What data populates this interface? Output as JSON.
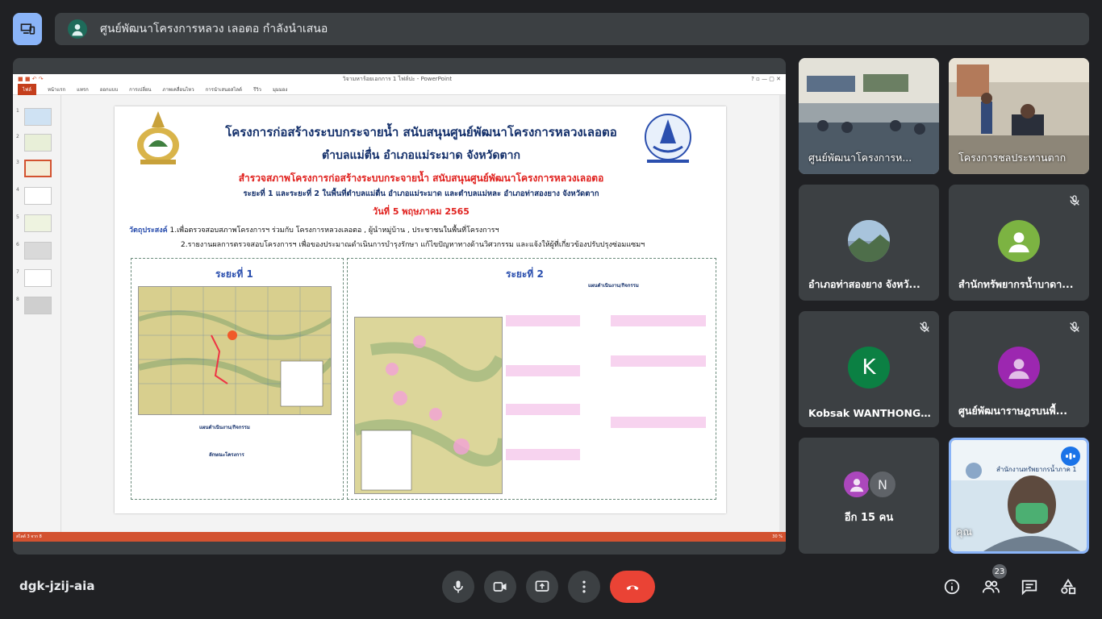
{
  "banner": {
    "title": "ศูนย์พัฒนาโครงการหลวง เลอตอ กำลังนำเสนอ"
  },
  "ppt": {
    "window_title": "วิจามหาร้อยเอกการ 1 ไฟล์ปะ - PowerPoint",
    "ribbon": [
      "ไฟล์",
      "หน้าแรก",
      "แทรก",
      "ออกแบบ",
      "การเปลี่ยน",
      "ภาพเคลื่อนไหว",
      "การนำเสนอสไลด์",
      "รีวิว",
      "มุมมอง"
    ],
    "thumb_numbers": [
      "1",
      "2",
      "3",
      "4",
      "5",
      "6",
      "7",
      "8"
    ],
    "status_left": "สไลด์ 3 จาก 8",
    "status_right": "30 %",
    "slide": {
      "title_line1": "โครงการก่อสร้างระบบกระจายน้ำ สนับสนุนศูนย์พัฒนาโครงการหลวงเลอตอ",
      "title_line2": "ตำบลแม่ตื่น อำเภอแม่ระมาด จังหวัดตาก",
      "subtitle_red": "สำรวจสภาพโครงการก่อสร้างระบบกระจายน้ำ สนับสนุนศูนย์พัฒนาโครงการหลวงเลอตอ",
      "subtitle_blue": "ระยะที่ 1 และระยะที่ 2 ในพื้นที่ตำบลแม่ตื่น อำเภอแม่ระมาด และตำบลแม่หละ อำเภอท่าสองยาง จังหวัดตาก",
      "date": "วันที่ 5 พฤษภาคม 2565",
      "objective_label": "วัตถุประสงค์",
      "objective_1": "1.เพื่อตรวจสอบสภาพโครงการฯ ร่วมกับ โครงการหลวงเลอตอ , ผู้นำหมู่บ้าน , ประชาชนในพื้นที่โครงการฯ",
      "objective_2": "2.รายงานผลการตรวจสอบโครงการฯ เพื่อของประมาณดำเนินการบำรุงรักษา แก้ไขปัญหาทางด้านวิศวกรรม และแจ้งให้ผู้ที่เกี่ยวข้องปรับปรุงซ่อมแซมฯ",
      "phase1": "ระยะที่ 1",
      "phase2": "ระยะที่ 2",
      "phase1_caption": "แผนดำเนินงาน/กิจกรรม",
      "phase1_features": "ลักษณะโครงการ",
      "phase2_caption": "แผนดำเนินงาน/กิจกรรม"
    }
  },
  "tiles": [
    {
      "name": "ศูนย์พัฒนาโครงการห...",
      "type": "video"
    },
    {
      "name": "โครงการชลประทานตาก",
      "type": "video"
    },
    {
      "name": "อำเภอท่าสองยาง จังหวั...",
      "type": "avatar-photo"
    },
    {
      "name": "สำนักทรัพยากรน้ำบาดา...",
      "type": "avatar",
      "color": "#7cb342"
    },
    {
      "name": "Kobsak WANTHONG...",
      "type": "letter",
      "letter": "K",
      "color": "#0b8043"
    },
    {
      "name": "ศูนย์พัฒนาราษฎรบนพื้...",
      "type": "avatar",
      "color": "#9c27b0"
    },
    {
      "name": "อีก 15 คน",
      "type": "more",
      "letter": "N"
    },
    {
      "name": "คุณ",
      "type": "self",
      "overlay": "สำนักงานทรัพยากรน้ำภาค 1"
    }
  ],
  "meeting_code": "dgk-jzij-aia",
  "participants_count": "23",
  "colors": {
    "background": "#202124",
    "tile": "#3c4043",
    "end_call": "#ea4335",
    "accent": "#8ab4f8"
  }
}
